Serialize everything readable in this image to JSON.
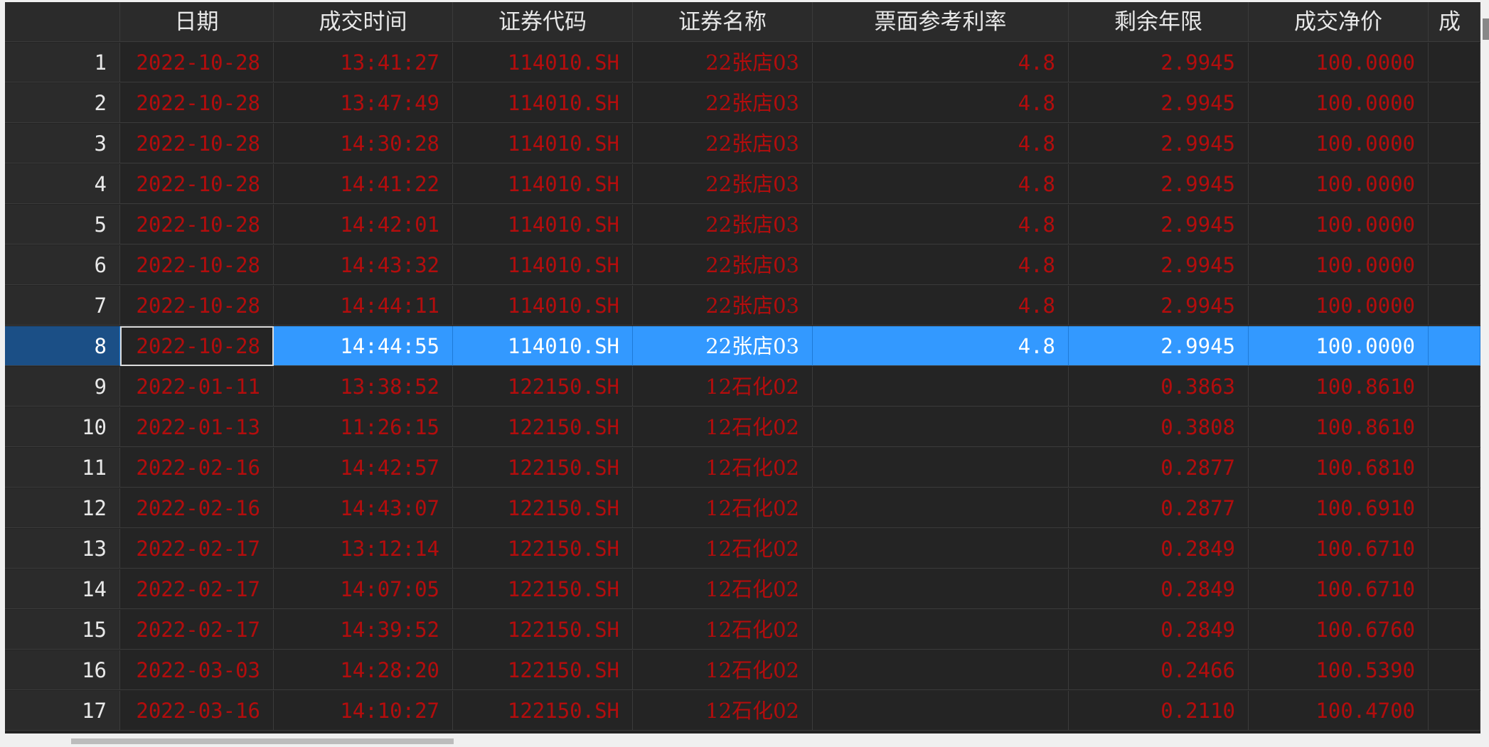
{
  "columns": [
    {
      "key": "date",
      "label": "日期"
    },
    {
      "key": "time",
      "label": "成交时间"
    },
    {
      "key": "code",
      "label": "证券代码"
    },
    {
      "key": "name",
      "label": "证券名称"
    },
    {
      "key": "rate",
      "label": "票面参考利率"
    },
    {
      "key": "years",
      "label": "剩余年限"
    },
    {
      "key": "price",
      "label": "成交净价"
    },
    {
      "key": "extra",
      "label": "成"
    }
  ],
  "selected_row": 8,
  "rows": [
    {
      "num": "1",
      "date": "2022-10-28",
      "time": "13:41:27",
      "code": "114010.SH",
      "name": "22张店03",
      "rate": "4.8",
      "years": "2.9945",
      "price": "100.0000"
    },
    {
      "num": "2",
      "date": "2022-10-28",
      "time": "13:47:49",
      "code": "114010.SH",
      "name": "22张店03",
      "rate": "4.8",
      "years": "2.9945",
      "price": "100.0000"
    },
    {
      "num": "3",
      "date": "2022-10-28",
      "time": "14:30:28",
      "code": "114010.SH",
      "name": "22张店03",
      "rate": "4.8",
      "years": "2.9945",
      "price": "100.0000"
    },
    {
      "num": "4",
      "date": "2022-10-28",
      "time": "14:41:22",
      "code": "114010.SH",
      "name": "22张店03",
      "rate": "4.8",
      "years": "2.9945",
      "price": "100.0000"
    },
    {
      "num": "5",
      "date": "2022-10-28",
      "time": "14:42:01",
      "code": "114010.SH",
      "name": "22张店03",
      "rate": "4.8",
      "years": "2.9945",
      "price": "100.0000"
    },
    {
      "num": "6",
      "date": "2022-10-28",
      "time": "14:43:32",
      "code": "114010.SH",
      "name": "22张店03",
      "rate": "4.8",
      "years": "2.9945",
      "price": "100.0000"
    },
    {
      "num": "7",
      "date": "2022-10-28",
      "time": "14:44:11",
      "code": "114010.SH",
      "name": "22张店03",
      "rate": "4.8",
      "years": "2.9945",
      "price": "100.0000"
    },
    {
      "num": "8",
      "date": "2022-10-28",
      "time": "14:44:55",
      "code": "114010.SH",
      "name": "22张店03",
      "rate": "4.8",
      "years": "2.9945",
      "price": "100.0000"
    },
    {
      "num": "9",
      "date": "2022-01-11",
      "time": "13:38:52",
      "code": "122150.SH",
      "name": "12石化02",
      "rate": "",
      "years": "0.3863",
      "price": "100.8610"
    },
    {
      "num": "10",
      "date": "2022-01-13",
      "time": "11:26:15",
      "code": "122150.SH",
      "name": "12石化02",
      "rate": "",
      "years": "0.3808",
      "price": "100.8610"
    },
    {
      "num": "11",
      "date": "2022-02-16",
      "time": "14:42:57",
      "code": "122150.SH",
      "name": "12石化02",
      "rate": "",
      "years": "0.2877",
      "price": "100.6810"
    },
    {
      "num": "12",
      "date": "2022-02-16",
      "time": "14:43:07",
      "code": "122150.SH",
      "name": "12石化02",
      "rate": "",
      "years": "0.2877",
      "price": "100.6910"
    },
    {
      "num": "13",
      "date": "2022-02-17",
      "time": "13:12:14",
      "code": "122150.SH",
      "name": "12石化02",
      "rate": "",
      "years": "0.2849",
      "price": "100.6710"
    },
    {
      "num": "14",
      "date": "2022-02-17",
      "time": "14:07:05",
      "code": "122150.SH",
      "name": "12石化02",
      "rate": "",
      "years": "0.2849",
      "price": "100.6710"
    },
    {
      "num": "15",
      "date": "2022-02-17",
      "time": "14:39:52",
      "code": "122150.SH",
      "name": "12石化02",
      "rate": "",
      "years": "0.2849",
      "price": "100.6760"
    },
    {
      "num": "16",
      "date": "2022-03-03",
      "time": "14:28:20",
      "code": "122150.SH",
      "name": "12石化02",
      "rate": "",
      "years": "0.2466",
      "price": "100.5390"
    },
    {
      "num": "17",
      "date": "2022-03-16",
      "time": "14:10:27",
      "code": "122150.SH",
      "name": "12石化02",
      "rate": "",
      "years": "0.2110",
      "price": "100.4700"
    }
  ],
  "colors": {
    "background": "#242424",
    "data_text": "#b30d0d",
    "header_text": "#e8e8e8",
    "selection": "#3399ff"
  }
}
